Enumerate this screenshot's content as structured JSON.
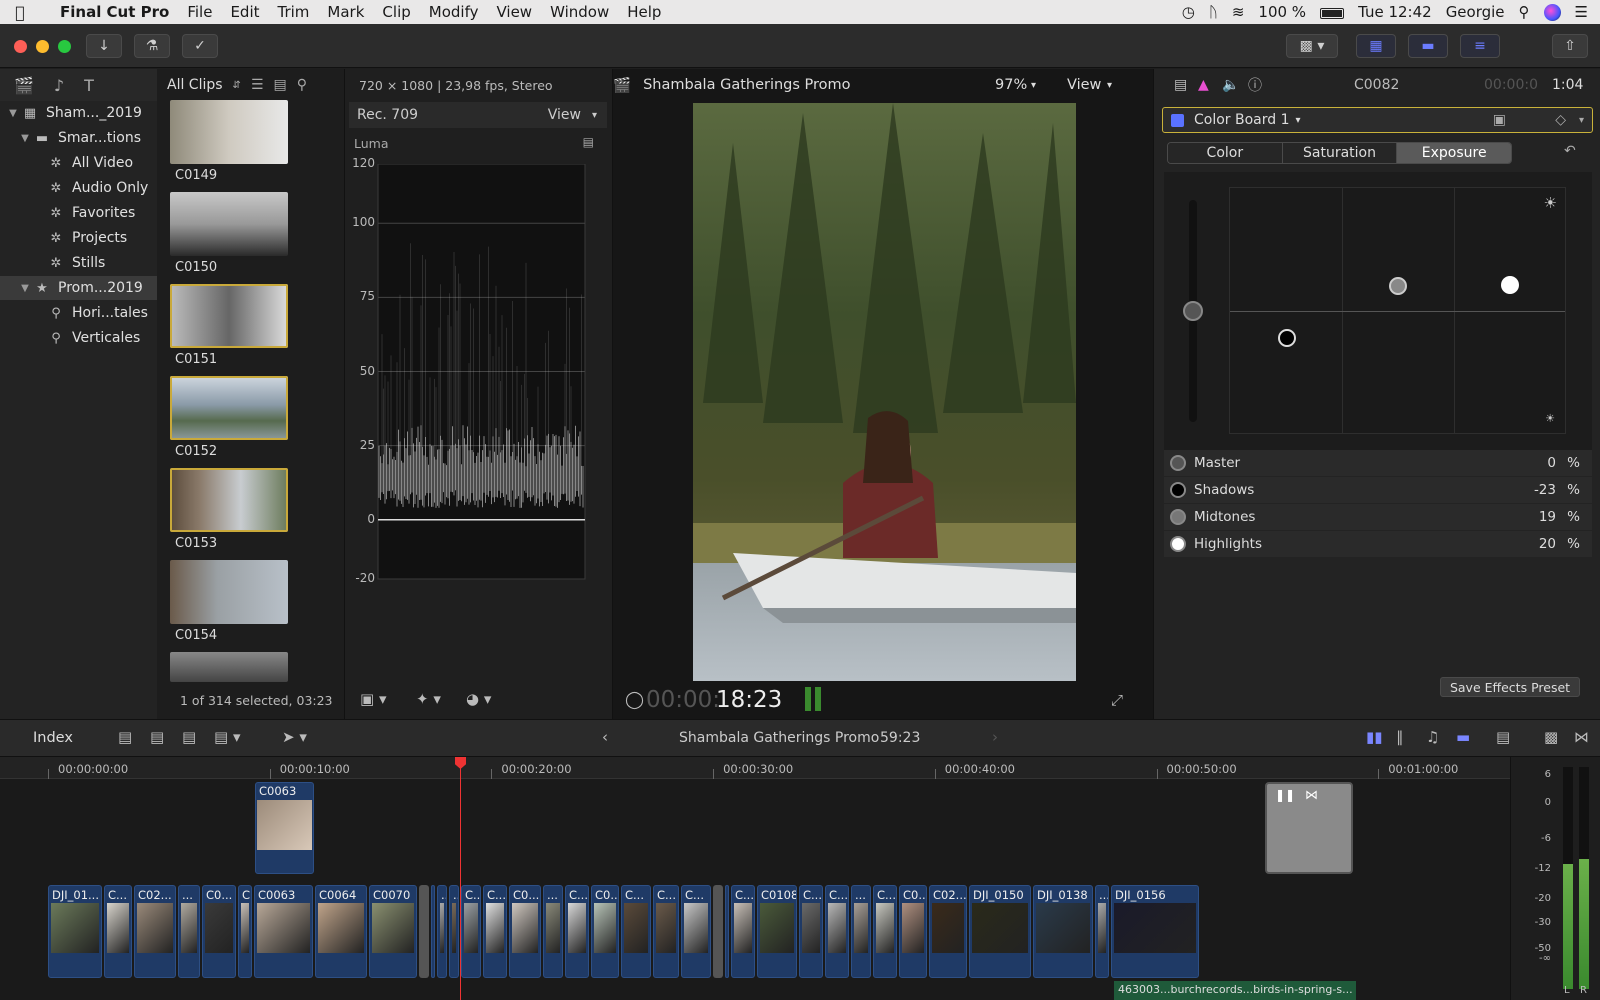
{
  "menubar": {
    "app_name": "Final Cut Pro",
    "items": [
      "File",
      "Edit",
      "Trim",
      "Mark",
      "Clip",
      "Modify",
      "View",
      "Window",
      "Help"
    ],
    "battery": "100 %",
    "clock": "Tue 12:42",
    "user": "Georgie"
  },
  "library": {
    "items": [
      {
        "label": "Sham..._2019",
        "icon": "library-icon",
        "tri": "▼"
      },
      {
        "label": "Smar...tions",
        "icon": "folder-icon",
        "tri": "▼"
      },
      {
        "label": "All Video",
        "icon": "gear-icon",
        "tri": ""
      },
      {
        "label": "Audio Only",
        "icon": "gear-icon",
        "tri": ""
      },
      {
        "label": "Favorites",
        "icon": "gear-icon",
        "tri": ""
      },
      {
        "label": "Projects",
        "icon": "gear-icon",
        "tri": ""
      },
      {
        "label": "Stills",
        "icon": "gear-icon",
        "tri": ""
      },
      {
        "label": "Prom...2019",
        "icon": "event-star-icon",
        "tri": "▼"
      },
      {
        "label": "Hori...tales",
        "icon": "keyword-icon",
        "tri": ""
      },
      {
        "label": "Verticales",
        "icon": "keyword-icon",
        "tri": ""
      }
    ]
  },
  "browser": {
    "filter": "All Clips",
    "clips": [
      "C0149",
      "C0150",
      "C0151",
      "C0152",
      "C0153",
      "C0154"
    ],
    "footer": "1 of 314 selected, 03:23"
  },
  "scope": {
    "info": "720 × 1080 | 23,98 fps, Stereo",
    "colorspace": "Rec. 709",
    "view": "View",
    "mode": "Luma",
    "y_labels": [
      "120",
      "100",
      "75",
      "50",
      "25",
      "0",
      "-20"
    ]
  },
  "viewer": {
    "title": "Shambala Gatherings Promo",
    "zoom": "97%",
    "view": "View",
    "timecode_dim": "00:00:",
    "timecode": "18:23"
  },
  "inspector": {
    "clip_name": "C0082",
    "duration_dim": "00:00:0",
    "duration": "1:04",
    "effect": "Color Board 1",
    "tabs": [
      "Color",
      "Saturation",
      "Exposure"
    ],
    "active_tab": 2,
    "params": [
      {
        "name": "Master",
        "value": "0",
        "unit": "%"
      },
      {
        "name": "Shadows",
        "value": "-23",
        "unit": "%"
      },
      {
        "name": "Midtones",
        "value": "19",
        "unit": "%"
      },
      {
        "name": "Highlights",
        "value": "20",
        "unit": "%"
      }
    ],
    "save_preset": "Save Effects Preset"
  },
  "timeline": {
    "index": "Index",
    "project": "Shambala Gatherings Promo",
    "duration": "59:23",
    "ruler": [
      "00:00:00:00",
      "00:00:10:00",
      "00:00:20:00",
      "00:00:30:00",
      "00:00:40:00",
      "00:00:50:00",
      "00:01:00:00"
    ],
    "connected_clip": "C0063",
    "clips": [
      "DJI_01...",
      "C...",
      "C02...",
      "...",
      "C0...",
      "C",
      "C0063",
      "C0064",
      "C0070",
      "...",
      "...",
      "...",
      "C...",
      "C...",
      "C0...",
      "...",
      "C...",
      "C0...",
      "C...",
      "C...",
      "C...",
      "...",
      "C...",
      "C0108",
      "C...",
      "C...",
      "...",
      "C...",
      "C0...",
      "C02...",
      "DJI_0150",
      "DJI_0138",
      "...",
      "DJI_0156"
    ],
    "audio_label": "463003...burchrecords...birds-in-spring-s...",
    "meter_labels": [
      "6",
      "0",
      "-6",
      "-12",
      "-20",
      "-30",
      "-50",
      "-∞"
    ],
    "meter_channels": [
      "L",
      "R"
    ]
  }
}
